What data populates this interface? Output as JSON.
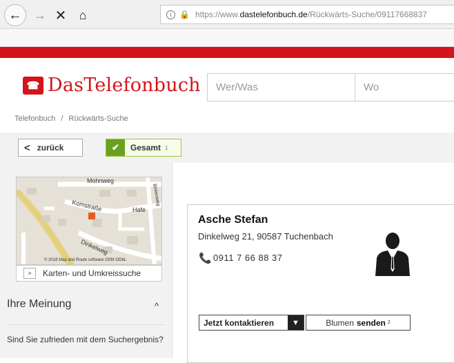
{
  "browser": {
    "url_proto": "https://www.",
    "url_domain": "dastelefonbuch.de",
    "url_path": "/Rückwärts-Suche/09117668837"
  },
  "header": {
    "logo_text": "DasTelefonbuch",
    "search_who_placeholder": "Wer/Was",
    "search_where_placeholder": "Wo"
  },
  "breadcrumb": {
    "home": "Telefonbuch",
    "separator": "/",
    "current": "Rückwärts-Suche"
  },
  "filters": {
    "back_label": "zurück",
    "total_label": "Gesamt",
    "total_count": "1"
  },
  "map": {
    "labels": [
      "Mohnweg",
      "Komstraße",
      "Hafe",
      "Dinkelweg",
      "Birkenweg"
    ],
    "credit": "© 2018 Map and Route software OSM ODbL",
    "link_label": "Karten- und Umkreissuche"
  },
  "opinion": {
    "heading": "Ihre Meinung",
    "question": "Sind Sie zufrieden mit dem Suchergebnis?"
  },
  "result": {
    "name": "Asche Stefan",
    "address": "Dinkelweg 21, 90587 Tuchenbach",
    "phone": "0911 7 66 88 37",
    "contact_button": "Jetzt kontaktieren",
    "flowers_prefix": "Blumen",
    "flowers_bold": "senden",
    "flowers_sup": "2"
  },
  "colors": {
    "brand_red": "#d4131a",
    "check_green": "#6aa01e"
  },
  "icons": {
    "back": "back-arrow-icon",
    "forward": "forward-arrow-icon",
    "stop": "close-icon",
    "home": "home-icon",
    "phone": "phone-icon",
    "avatar": "person-avatar-icon"
  }
}
